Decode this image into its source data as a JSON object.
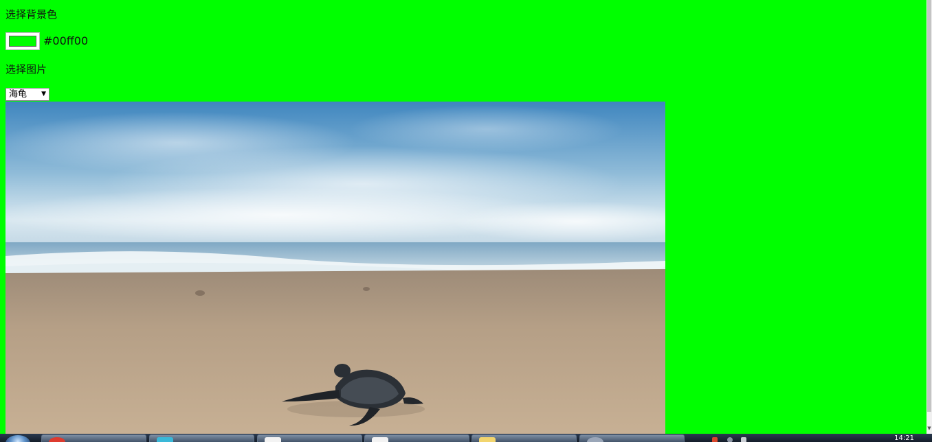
{
  "bg_color_label": "选择背景色",
  "color_picker": {
    "value": "#00ff00",
    "display_text": "#00ff00"
  },
  "image_label": "选择图片",
  "image_select": {
    "selected": "海龟"
  },
  "colors": {
    "page_background": "#00ff00"
  },
  "taskbar": {
    "clock": "14:21",
    "items": [
      {
        "name": "chrome-task",
        "icon": "chrome-icon",
        "color": "#dd3b2f"
      },
      {
        "name": "app-task",
        "icon": "app-icon",
        "color": "#3ab8d8"
      },
      {
        "name": "folder-task-1",
        "icon": "folder-icon",
        "color": "#f3f3f3"
      },
      {
        "name": "folder-task-2",
        "icon": "folder-icon",
        "color": "#f3f3f3"
      },
      {
        "name": "folder-task-3",
        "icon": "folder-icon",
        "color": "#f2d56e"
      },
      {
        "name": "user-task",
        "icon": "user-icon",
        "color": "#9aa6b8"
      }
    ]
  }
}
